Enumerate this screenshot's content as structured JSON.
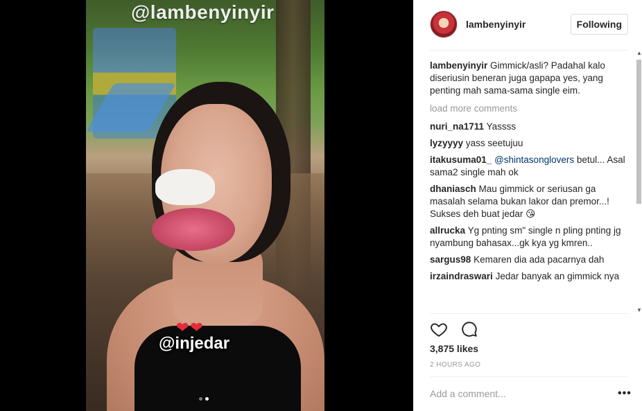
{
  "media": {
    "watermark": "@lambenyinyir",
    "hearts": "❤❤",
    "tag": "@injedar",
    "carousel": {
      "count": 2,
      "active": 2
    }
  },
  "header": {
    "username": "lambenyinyir",
    "follow_label": "Following"
  },
  "caption": {
    "username": "lambenyinyir",
    "text": "Gimmick/asli? Padahal kalo diseriusin beneran juga gapapa yes, yang penting mah sama-sama single eim."
  },
  "load_more_label": "load more comments",
  "comments": [
    {
      "user": "nuri_na1711",
      "text": "Yassss"
    },
    {
      "user": "lyzyyyy",
      "text": "yass seetujuu"
    },
    {
      "user": "itakusuma01_",
      "mention": "@shintasonglovers",
      "text": " betul... Asal sama2 single mah ok"
    },
    {
      "user": "dhaniasch",
      "text": "Mau gimmick or seriusan ga masalah selama bukan lakor dan premor...! Sukses deh buat jedar 😘"
    },
    {
      "user": "allrucka",
      "text": "Yg pnting sm\" single n pling pnting jg nyambung bahasax...gk kya yg kmren.."
    },
    {
      "user": "sargus98",
      "text": "Kemaren dia ada pacarnya dah"
    },
    {
      "user": "irzaindraswari",
      "text": "Jedar banyak an gimmick nya"
    }
  ],
  "likes": "3,875 likes",
  "timestamp": "2 HOURS AGO",
  "add_comment_placeholder": "Add a comment...",
  "more_label": "•••",
  "icons": {
    "like": "heart-icon",
    "comment": "speech-bubble-icon",
    "more": "ellipsis-icon"
  }
}
